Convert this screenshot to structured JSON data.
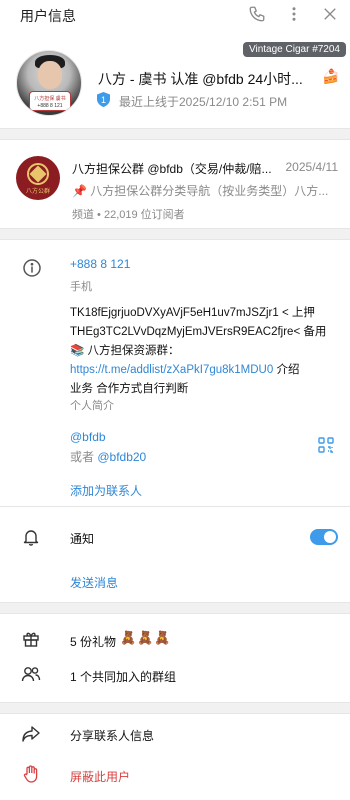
{
  "header": {
    "title": "用户信息",
    "icons": [
      "phone-icon",
      "more-vertical-icon",
      "close-icon"
    ]
  },
  "tooltip": "Vintage Cigar #7204",
  "profile": {
    "name": "八方 - 虞书 认准 @bfdb 24小时...",
    "name_emoji": "🍰",
    "verification": "shield-icon",
    "last_seen": "最近上线于2025/12/10 2:51 PM",
    "avatar_badge_text": "八方担保 虞书",
    "avatar_badge_number": "+888 8 121"
  },
  "channel": {
    "avatar_text": "八方公群",
    "title": "八方担保公群 @bfdb（交易/仲裁/赔...",
    "date": "2025/4/11",
    "preview_pin": "📌",
    "preview": "八方担保公群分类导航（按业务类型）八方...",
    "meta": "频道 • 22,019 位订阅者"
  },
  "info": {
    "phone": "+888 8 121",
    "phone_label": "手机",
    "bio_line1": "TK18fEjgrjuoDVXyAVjF5eH1uv7mJSZjr1 < 上押",
    "bio_line2": "THEg3TC2LVvDqzMyjEmJVErsR9EAC2fjre< 备用",
    "bio_line3": "📚 八方担保资源群：",
    "bio_link": "https://t.me/addlist/zXaPkI7gu8k1MDU0",
    "bio_line4_tail": " 介绍",
    "bio_line5": "业务 合作方式自行判断",
    "bio_label": "个人简介",
    "username": "@bfdb",
    "username_alt_prefix": "或者 ",
    "username_alt": "@bfdb20",
    "add_contact": "添加为联系人"
  },
  "notifications": {
    "label": "通知",
    "enabled": true,
    "send_message": "发送消息"
  },
  "extras": {
    "gifts_label": "5 份礼物",
    "gifts_emoji": "🧸🧸🧸",
    "groups_label": "1 个共同加入的群组"
  },
  "actions": {
    "share": "分享联系人信息",
    "block": "屏蔽此用户"
  },
  "colors": {
    "link": "#2f87d6",
    "danger": "#d84141",
    "toggle_on": "#3d9be9",
    "muted": "#8a8a8a"
  }
}
